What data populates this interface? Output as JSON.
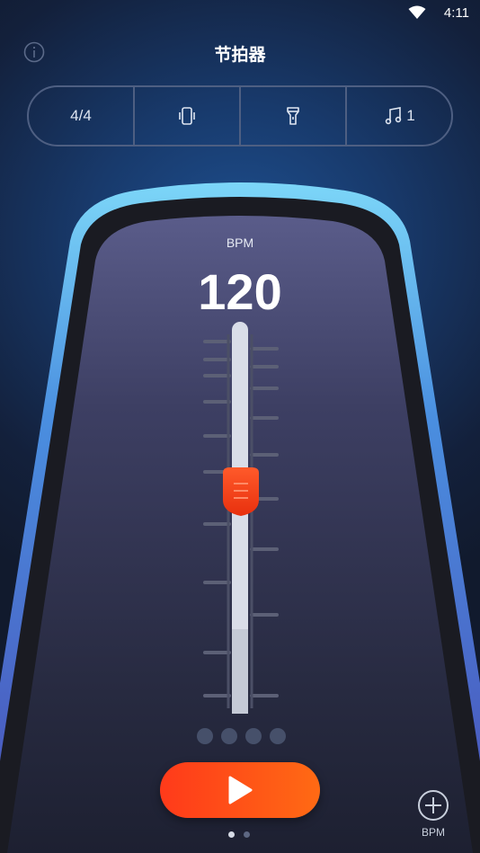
{
  "status_bar": {
    "time": "4:11"
  },
  "header": {
    "title": "节拍器"
  },
  "toolbar": {
    "time_signature": "4/4",
    "sound_number": "1",
    "icons": [
      "vibrate-phone-icon",
      "flashlight-icon",
      "music-note-icon"
    ]
  },
  "tempo": {
    "label": "BPM",
    "value": "120"
  },
  "beats": {
    "count": 4
  },
  "controls": {
    "add_bpm_label": "BPM"
  },
  "pager": {
    "pages": 2,
    "active": 0
  },
  "colors": {
    "accent": "#ff4a18",
    "rim": "#5fc4f2",
    "panel": "#3c3f66"
  }
}
